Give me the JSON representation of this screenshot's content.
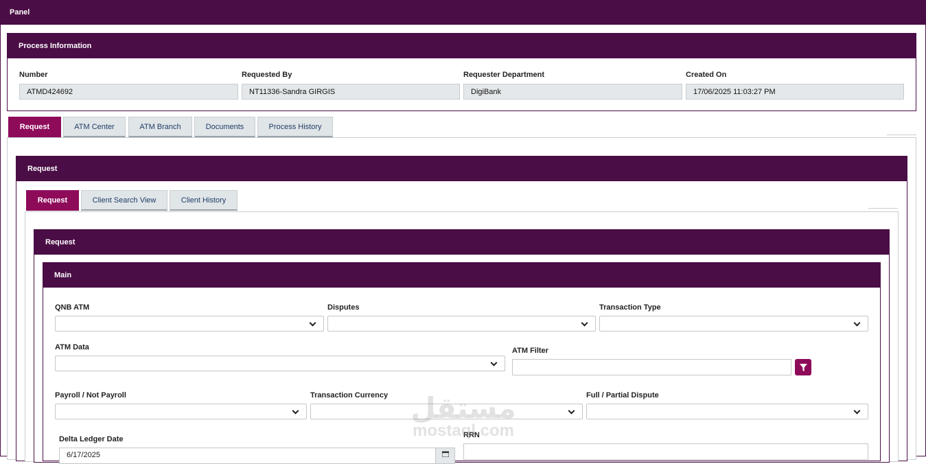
{
  "panel": {
    "title": "Panel"
  },
  "process_info": {
    "title": "Process Information",
    "fields": [
      {
        "label": "Number",
        "value": "ATMD424692"
      },
      {
        "label": "Requested By",
        "value": "NT11336-Sandra GIRGIS"
      },
      {
        "label": "Requester Department",
        "value": "DigiBank"
      },
      {
        "label": "Created On",
        "value": "17/06/2025 11:03:27 PM"
      }
    ]
  },
  "outer_tabs": [
    "Request",
    "ATM Center",
    "ATM Branch",
    "Documents",
    "Process History"
  ],
  "request_section": {
    "title": "Request"
  },
  "inner_tabs": [
    "Request",
    "Client Search View",
    "Client History"
  ],
  "inner_request_section": {
    "title": "Request"
  },
  "main_section": {
    "title": "Main",
    "qnb_atm": {
      "label": "QNB ATM",
      "value": ""
    },
    "disputes": {
      "label": "Disputes",
      "value": ""
    },
    "transaction_type": {
      "label": "Transaction Type",
      "value": ""
    },
    "atm_data": {
      "label": "ATM Data",
      "value": ""
    },
    "atm_filter": {
      "label": "ATM Filter",
      "value": ""
    },
    "payroll": {
      "label": "Payroll / Not Payroll",
      "value": ""
    },
    "transaction_currency": {
      "label": "Transaction Currency",
      "value": ""
    },
    "full_partial_dispute": {
      "label": "Full / Partial Dispute",
      "value": ""
    },
    "delta_ledger_date": {
      "label": "Delta Ledger Date",
      "value": "6/17/2025"
    },
    "rrn": {
      "label": "RRN",
      "value": ""
    }
  },
  "watermark": {
    "arabic": "مستقل",
    "latin": "mostaql.com"
  },
  "colors": {
    "header": "#4a0d45",
    "active_tab": "#8e0b5a",
    "tab_bg": "#e0e5e8",
    "readonly_bg": "#e4e8ea"
  }
}
